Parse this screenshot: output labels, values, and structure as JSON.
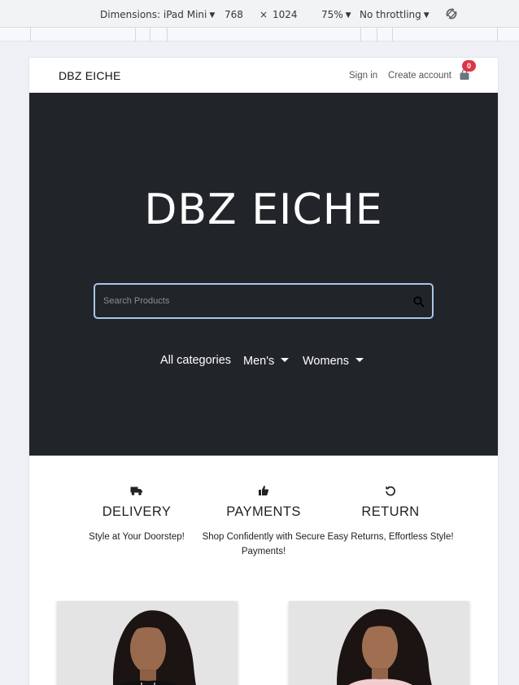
{
  "devtools": {
    "dimensions_label": "Dimensions: iPad Mini",
    "width": "768",
    "times": "×",
    "height": "1024",
    "zoom": "75%",
    "throttling": "No throttling",
    "rotate_icon": "rotate-icon"
  },
  "navbar": {
    "brand": "DBZ EICHE",
    "sign_in": "Sign in",
    "create_account": "Create account",
    "cart_count": "0",
    "cart_icon": "shopping-bag-icon"
  },
  "hero": {
    "title": "DBZ EICHE",
    "search_placeholder": "Search Products",
    "search_icon": "search-icon",
    "categories": {
      "all": "All categories",
      "mens": "Men's",
      "womens": "Womens"
    }
  },
  "features": [
    {
      "icon": "truck-icon",
      "title": "DELIVERY",
      "description": "Style at Your Doorstep!"
    },
    {
      "icon": "thumbs-up-icon",
      "title": "PAYMENTS",
      "description": "Shop Confidently with Secure Payments!"
    },
    {
      "icon": "undo-icon",
      "title": "RETURN",
      "description": "Easy Returns, Effortless Style!"
    }
  ],
  "colors": {
    "hero_bg": "#212529",
    "badge": "#dc3545",
    "search_border": "#a9c5e8"
  }
}
